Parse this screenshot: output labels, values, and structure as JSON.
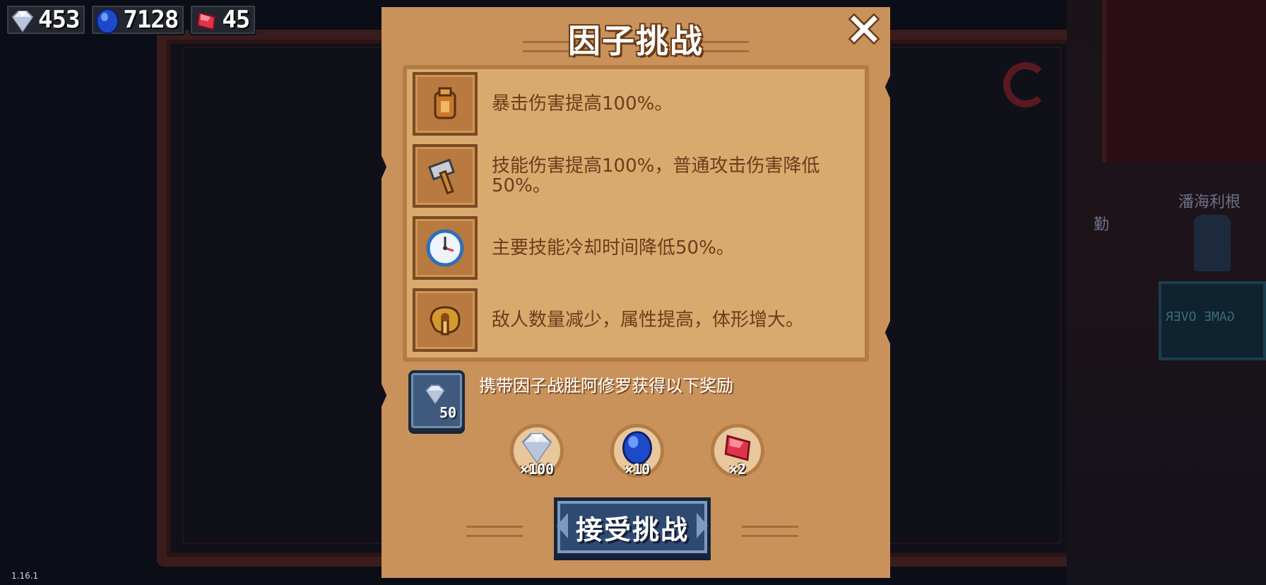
{
  "version": "1.16.1",
  "currency": [
    {
      "icon": "diamond-icon",
      "value": "453"
    },
    {
      "icon": "sapphire-icon",
      "value": "7128"
    },
    {
      "icon": "ruby-icon",
      "value": "45"
    }
  ],
  "background": {
    "npc_name": "潘海利根",
    "npc_side": "勤",
    "counter_sign": "GAME OVER"
  },
  "dialog": {
    "title": "因子挑战",
    "factors": [
      {
        "icon": "armor-vest-icon",
        "text": "暴击伤害提高100%。"
      },
      {
        "icon": "hammer-icon",
        "text": "技能伤害提高100%，普通攻击伤害降低50%。"
      },
      {
        "icon": "clock-icon",
        "text": "主要技能冷却时间降低50%。"
      },
      {
        "icon": "horn-icon",
        "text": "敌人数量减少，属性提高，体形增大。"
      }
    ],
    "reward_cost": "50",
    "reward_desc": "携带因子战胜阿修罗获得以下奖励",
    "rewards": [
      {
        "icon": "diamond-icon",
        "count": "×100"
      },
      {
        "icon": "sapphire-icon",
        "count": "×10"
      },
      {
        "icon": "ruby-icon",
        "count": "×2"
      }
    ],
    "accept_label": "接受挑战"
  },
  "colors": {
    "panel": "#c9925b",
    "text_brown": "#6b3d1b",
    "button_blue": "#2e4a72",
    "ribbon_red": "#c9393a"
  }
}
